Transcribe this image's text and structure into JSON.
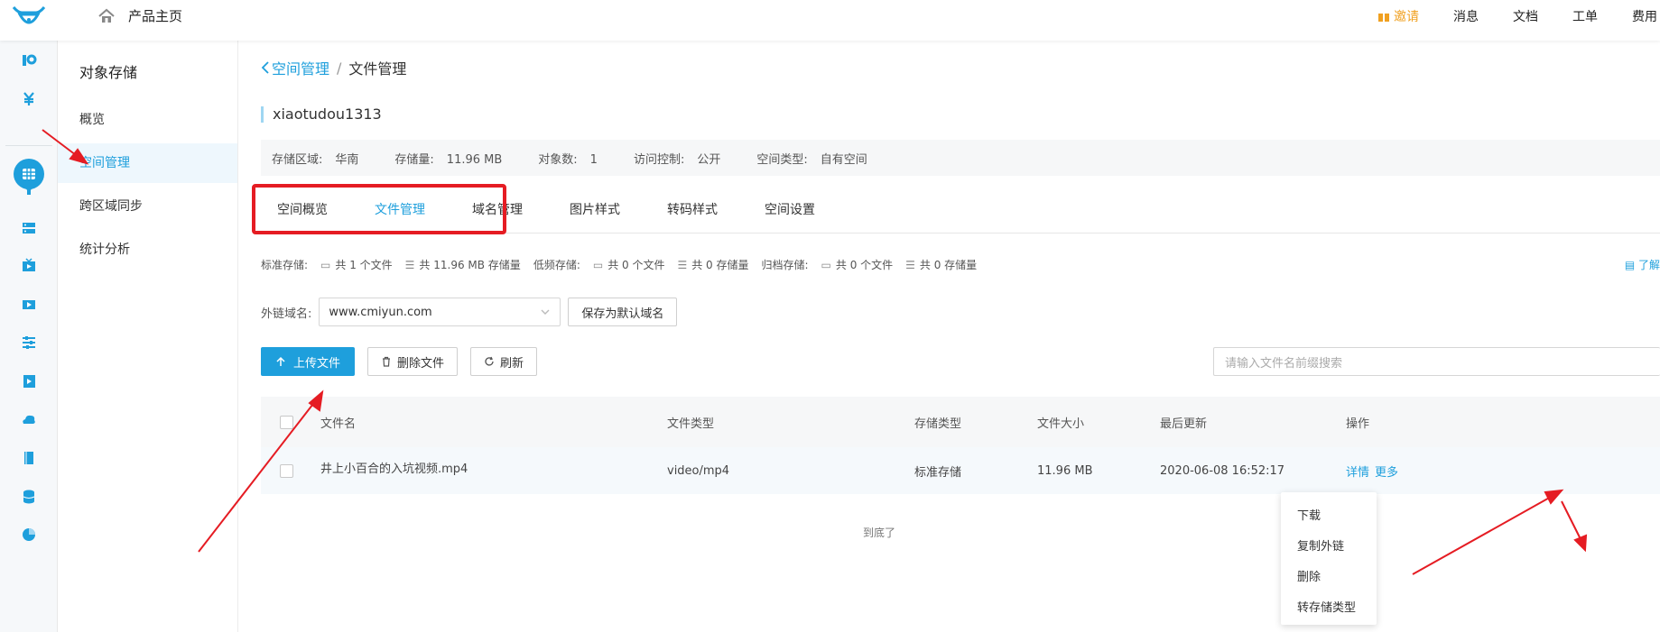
{
  "topbar": {
    "home_label": "产品主页",
    "nav": {
      "invite": "邀请",
      "messages": "消息",
      "docs": "文档",
      "tickets": "工单",
      "billing": "费用"
    }
  },
  "subnav": {
    "title": "对象存储",
    "items": [
      "概览",
      "空间管理",
      "跨区域同步",
      "统计分析"
    ]
  },
  "breadcrumb": {
    "back": "空间管理",
    "separator": "/",
    "current": "文件管理"
  },
  "bucket_name": "xiaotudou1313",
  "info": {
    "region_label": "存储区域:",
    "region": "华南",
    "storage_label": "存储量:",
    "storage": "11.96 MB",
    "objects_label": "对象数:",
    "objects": "1",
    "access_label": "访问控制:",
    "access": "公开",
    "type_label": "空间类型:",
    "type": "自有空间"
  },
  "tabs": [
    "空间概览",
    "文件管理",
    "域名管理",
    "图片样式",
    "转码样式",
    "空间设置"
  ],
  "stats": {
    "standard_label": "标准存储:",
    "standard_files": "共 1 个文件",
    "standard_size": "共 11.96 MB 存储量",
    "low_label": "低频存储:",
    "low_files": "共 0 个文件",
    "low_size": "共 0 存储量",
    "archive_label": "归档存储:",
    "archive_files": "共 0 个文件",
    "archive_size": "共 0 存储量",
    "learn_more": "了解"
  },
  "domain": {
    "label": "外链域名:",
    "value": "www.cmiyun.com",
    "save_button": "保存为默认域名"
  },
  "toolbar": {
    "upload": "上传文件",
    "delete": "删除文件",
    "refresh": "刷新",
    "search_placeholder": "请输入文件名前缀搜索"
  },
  "table": {
    "headers": [
      "文件名",
      "文件类型",
      "存储类型",
      "文件大小",
      "最后更新",
      "操作"
    ],
    "rows": [
      {
        "name": "井上小百合的入坑视频.mp4",
        "type": "video/mp4",
        "storage": "标准存储",
        "size": "11.96 MB",
        "updated": "2020-06-08 16:52:17",
        "detail": "详情",
        "more": "更多"
      }
    ],
    "end_text": "到底了"
  },
  "dropdown": [
    "下载",
    "复制外链",
    "删除",
    "转存储类型"
  ],
  "colors": {
    "accent": "#1e9fdc",
    "highlight": "#e51c23",
    "invite": "#f0a020"
  }
}
